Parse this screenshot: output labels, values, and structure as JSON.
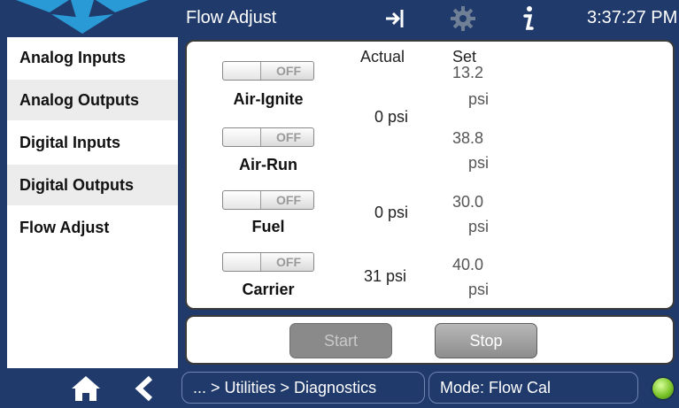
{
  "header": {
    "title": "Flow Adjust",
    "clock": "3:37:27 PM",
    "icons": [
      "logo",
      "exit-icon",
      "gear-icon",
      "info-icon"
    ]
  },
  "sidebar": {
    "items": [
      {
        "label": "Analog Inputs"
      },
      {
        "label": "Analog Outputs"
      },
      {
        "label": "Digital Inputs"
      },
      {
        "label": "Digital Outputs"
      },
      {
        "label": "Flow Adjust"
      }
    ]
  },
  "flow": {
    "headers": {
      "actual": "Actual",
      "set": "Set"
    },
    "channels": [
      {
        "name": "Air-Ignite",
        "toggle": "OFF",
        "actual": "0 psi",
        "set": "13.2",
        "unit": "psi"
      },
      {
        "name": "Air-Run",
        "toggle": "OFF",
        "actual": "",
        "set": "38.8",
        "unit": "psi"
      },
      {
        "name": "Fuel",
        "toggle": "OFF",
        "actual": "0 psi",
        "set": "30.0",
        "unit": "psi"
      },
      {
        "name": "Carrier",
        "toggle": "OFF",
        "actual": "31 psi",
        "set": "40.0",
        "unit": "psi"
      }
    ]
  },
  "buttons": {
    "start": "Start",
    "stop": "Stop"
  },
  "footer": {
    "breadcrumb": "... > Utilities > Diagnostics",
    "mode": "Mode: Flow Cal",
    "status_led_color": "#7cc52b"
  },
  "colors": {
    "bar": "#1f3a6b",
    "panel": "#ffffff"
  }
}
